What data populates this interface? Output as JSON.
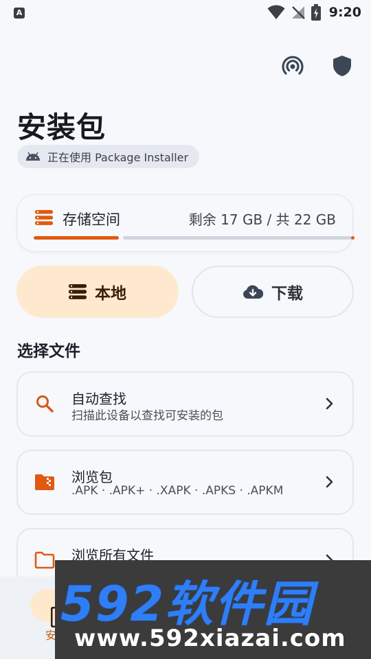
{
  "status_bar": {
    "app_glyph": "A",
    "time": "9:20"
  },
  "header": {
    "title": "安装包",
    "installer_chip": "正在使用 Package Installer"
  },
  "storage": {
    "label": "存储空间",
    "value": "剩余 17 GB / 共 22 GB",
    "used_fraction": 0.23,
    "accent_color": "#e05a10"
  },
  "tabs": [
    {
      "label": "本地",
      "icon": "list-icon",
      "selected": true
    },
    {
      "label": "下载",
      "icon": "cloud-download-icon",
      "selected": false
    }
  ],
  "section_title": "选择文件",
  "items": [
    {
      "title": "自动查找",
      "subtitle": "扫描此设备以查找可安装的包",
      "icon": "search-icon"
    },
    {
      "title": "浏览包",
      "subtitle": ".APK · .APK+ · .XAPK · .APKS · .APKM",
      "icon": "zip-folder-icon"
    },
    {
      "title": "浏览所有文件",
      "subtitle": "",
      "icon": "folder-icon"
    }
  ],
  "bottom_nav": {
    "first_label": "安"
  },
  "watermark": {
    "brand": "592软件园",
    "url": "www.592xiazai.com"
  }
}
